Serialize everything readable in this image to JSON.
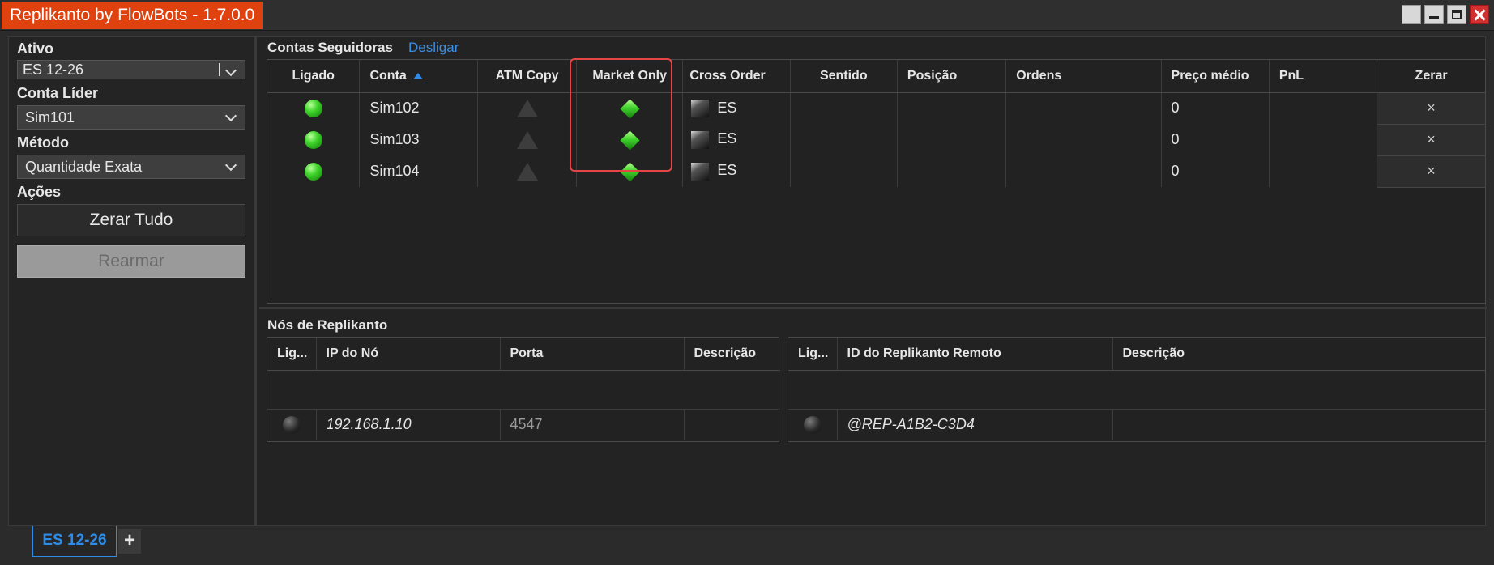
{
  "window": {
    "title": "Replikanto by FlowBots - 1.7.0.0"
  },
  "left": {
    "ativo_label": "Ativo",
    "ativo_value": "ES 12-26",
    "conta_lider_label": "Conta Líder",
    "conta_lider_value": "Sim101",
    "metodo_label": "Método",
    "metodo_value": "Quantidade Exata",
    "acoes_label": "Ações",
    "zerar_tudo": "Zerar Tudo",
    "rearmar": "Rearmar"
  },
  "followers": {
    "title": "Contas Seguidoras",
    "link": "Desligar",
    "columns": [
      "Ligado",
      "Conta",
      "ATM Copy",
      "Market Only",
      "Cross Order",
      "Sentido",
      "Posição",
      "Ordens",
      "Preço médio",
      "PnL",
      "Zerar"
    ],
    "rows": [
      {
        "conta": "Sim102",
        "cross": "ES",
        "preco": "0",
        "zerar": "×"
      },
      {
        "conta": "Sim103",
        "cross": "ES",
        "preco": "0",
        "zerar": "×"
      },
      {
        "conta": "Sim104",
        "cross": "ES",
        "preco": "0",
        "zerar": "×"
      }
    ]
  },
  "nodes": {
    "title": "Nós de Replikanto",
    "local_columns": [
      "Lig...",
      "IP do Nó",
      "Porta",
      "Descrição"
    ],
    "local_row": {
      "ip": "192.168.1.10",
      "porta": "4547"
    },
    "remote_columns": [
      "Lig...",
      "ID do Replikanto Remoto",
      "Descrição"
    ],
    "remote_row": {
      "id": "@REP-A1B2-C3D4"
    }
  },
  "tabs": {
    "active": "ES 12-26",
    "add": "+"
  },
  "icons": {
    "ligado": "green-ball-icon",
    "atm_copy": "dark-triangle-icon",
    "market_only": "green-diamond-icon",
    "cross_order": "dark-square-icon",
    "node_status": "dark-ball-icon"
  },
  "colors": {
    "title_bg": "#e0420f",
    "accent": "#2f8ce6",
    "highlight": "#e64545"
  }
}
